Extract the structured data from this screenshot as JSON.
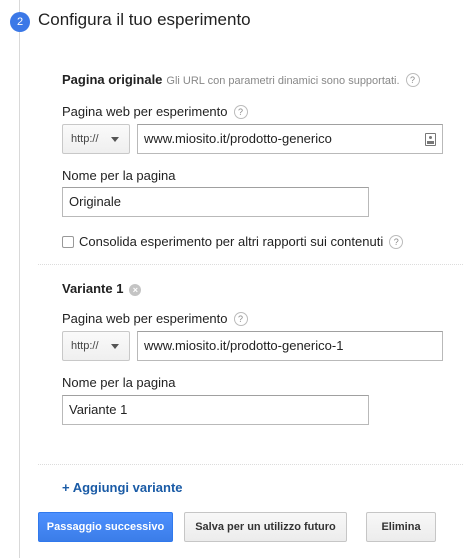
{
  "step": {
    "number": "2",
    "title": "Configura il tuo esperimento"
  },
  "original": {
    "heading": "Pagina originale",
    "hint": "Gli URL con parametri dinamici sono supportati.",
    "url_label": "Pagina web per esperimento",
    "protocol": "http://",
    "url_value": "www.miosito.it/prodotto-generico",
    "name_label": "Nome per la pagina",
    "name_value": "Originale",
    "consolidate_label": "Consolida esperimento per altri rapporti sui contenuti",
    "consolidate_checked": false
  },
  "variant": {
    "heading": "Variante 1",
    "url_label": "Pagina web per esperimento",
    "protocol": "http://",
    "url_value": "www.miosito.it/prodotto-generico-1",
    "name_label": "Nome per la pagina",
    "name_value": "Variante 1"
  },
  "add_variant": "+ Aggiungi variante",
  "buttons": {
    "next": "Passaggio successivo",
    "save": "Salva per un utilizzo futuro",
    "delete": "Elimina"
  },
  "colors": {
    "primary": "#3b7de8",
    "link": "#1a5ba6",
    "step": "#3b78e7"
  },
  "icons": {
    "help": "question-circle-icon",
    "remove": "remove-x-icon",
    "field": "contact-card-icon",
    "dropdown": "caret-down-icon"
  }
}
